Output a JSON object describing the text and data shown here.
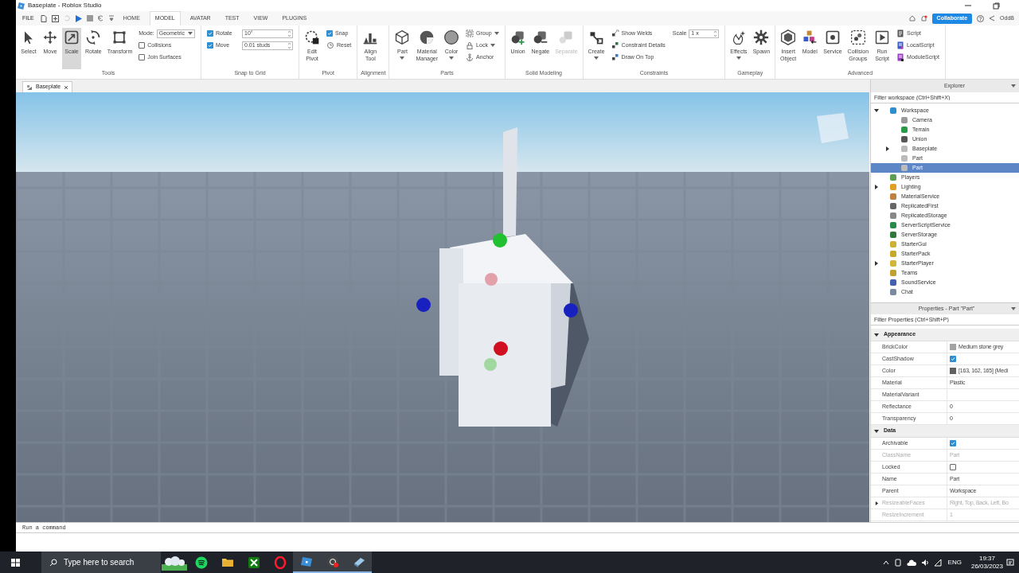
{
  "window": {
    "title": "Baseplate - Roblox Studio"
  },
  "menu": {
    "file": "FILE",
    "tabs": [
      {
        "label": "HOME",
        "selected": false
      },
      {
        "label": "MODEL",
        "selected": true
      },
      {
        "label": "AVATAR",
        "selected": false
      },
      {
        "label": "TEST",
        "selected": false
      },
      {
        "label": "VIEW",
        "selected": false
      },
      {
        "label": "PLUGINS",
        "selected": false
      }
    ],
    "collaborate": "Collaborate",
    "user": "OddB"
  },
  "ribbon": [
    {
      "title": "Tools",
      "items": [
        {
          "kind": "big",
          "label": "Select",
          "selected": false
        },
        {
          "kind": "big",
          "label": "Move",
          "selected": false
        },
        {
          "kind": "big",
          "label": "Scale",
          "selected": true
        },
        {
          "kind": "big",
          "label": "Rotate",
          "selected": false
        },
        {
          "kind": "big",
          "label": "Transform",
          "selected": false
        },
        {
          "kind": "stack",
          "items": [
            {
              "kind": "dropdown",
              "label": "Mode:",
              "value": "Geometric"
            },
            {
              "kind": "check",
              "label": "Collisions",
              "checked": false
            },
            {
              "kind": "check",
              "label": "Join Surfaces",
              "checked": false
            }
          ]
        }
      ]
    },
    {
      "title": "Snap to Grid",
      "items": [
        {
          "kind": "stack",
          "items": [
            {
              "kind": "check_field",
              "label": "Rotate",
              "checked": true,
              "value": "10°"
            },
            {
              "kind": "check_field",
              "label": "Move",
              "checked": true,
              "value": "0.01 studs"
            }
          ]
        }
      ]
    },
    {
      "title": "Pivot",
      "items": [
        {
          "kind": "big",
          "label": "Edit Pivot"
        },
        {
          "kind": "stack",
          "items": [
            {
              "kind": "check",
              "label": "Snap",
              "checked": true
            },
            {
              "kind": "small",
              "label": "Reset",
              "menu": false
            }
          ]
        }
      ]
    },
    {
      "title": "Alignment",
      "items": [
        {
          "kind": "big",
          "label": "Align Tool"
        }
      ]
    },
    {
      "title": "Parts",
      "items": [
        {
          "kind": "big",
          "label": "Part",
          "dropdown": true
        },
        {
          "kind": "big",
          "label": "Material Manager",
          "dropdown": false
        },
        {
          "kind": "big",
          "label": "Color",
          "dropdown": true
        },
        {
          "kind": "stack",
          "items": [
            {
              "kind": "small",
              "label": "Group",
              "menu": true
            },
            {
              "kind": "small",
              "label": "Lock",
              "menu": true
            },
            {
              "kind": "small",
              "label": "Anchor",
              "menu": false
            }
          ]
        }
      ]
    },
    {
      "title": "Solid Modeling",
      "items": [
        {
          "kind": "big",
          "label": "Union",
          "disabled": false
        },
        {
          "kind": "big",
          "label": "Negate",
          "disabled": false
        },
        {
          "kind": "big",
          "label": "Separate",
          "disabled": true
        }
      ]
    },
    {
      "title": "Constraints",
      "items": [
        {
          "kind": "big",
          "label": "Create",
          "dropdown": true
        },
        {
          "kind": "stack",
          "items": [
            {
              "kind": "small",
              "label": "Show Welds",
              "menu": false
            },
            {
              "kind": "small",
              "label": "Constraint Details",
              "menu": false
            },
            {
              "kind": "small",
              "label": "Draw On Top",
              "menu": false
            }
          ]
        },
        {
          "kind": "stack",
          "items": [
            {
              "kind": "field",
              "label": "Scale",
              "value": "1 x"
            }
          ]
        }
      ]
    },
    {
      "title": "Gameplay",
      "items": [
        {
          "kind": "big",
          "label": "Effects",
          "dropdown": true
        },
        {
          "kind": "big",
          "label": "Spawn",
          "dropdown": false
        }
      ]
    },
    {
      "title": "Advanced",
      "items": [
        {
          "kind": "big",
          "label": "Insert Object"
        },
        {
          "kind": "big",
          "label": "Model"
        },
        {
          "kind": "big",
          "label": "Service"
        },
        {
          "kind": "big",
          "label": "Collision Groups"
        },
        {
          "kind": "big",
          "label": "Run Script"
        },
        {
          "kind": "stack",
          "items": [
            {
              "kind": "small",
              "label": "Script",
              "menu": false
            },
            {
              "kind": "small",
              "label": "LocalScript",
              "menu": false
            },
            {
              "kind": "small",
              "label": "ModuleScript",
              "menu": false
            }
          ]
        }
      ]
    }
  ],
  "document_tabs": [
    {
      "label": "Baseplate",
      "selected": true
    }
  ],
  "explorer": {
    "title": "Explorer",
    "filter": {
      "placeholder": "Filter workspace (Ctrl+Shift+X)"
    },
    "items": [
      {
        "label": "Workspace",
        "color": "#2a8fd0",
        "selected": false,
        "expanded": true,
        "children": [
          {
            "label": "Camera",
            "color": "#9a9a9a",
            "selected": false
          },
          {
            "label": "Terrain",
            "color": "#2a9a4a",
            "selected": false
          },
          {
            "label": "Union",
            "color": "#555555",
            "selected": false
          },
          {
            "label": "Baseplate",
            "color": "#bbbbbb",
            "selected": false,
            "expanded": false
          },
          {
            "label": "Part",
            "color": "#bbbbbb",
            "selected": false
          },
          {
            "label": "Part",
            "color": "#bbbbbb",
            "selected": true
          }
        ]
      },
      {
        "label": "Players",
        "color": "#5aa050",
        "selected": false
      },
      {
        "label": "Lighting",
        "color": "#e0a020",
        "selected": false,
        "expanded": false
      },
      {
        "label": "MaterialService",
        "color": "#c08040",
        "selected": false
      },
      {
        "label": "ReplicatedFirst",
        "color": "#666666",
        "selected": false
      },
      {
        "label": "ReplicatedStorage",
        "color": "#888888",
        "selected": false
      },
      {
        "label": "ServerScriptService",
        "color": "#2a8a4a",
        "selected": false
      },
      {
        "label": "ServerStorage",
        "color": "#2f7a3a",
        "selected": false
      },
      {
        "label": "StarterGui",
        "color": "#d0b030",
        "selected": false
      },
      {
        "label": "StarterPack",
        "color": "#c8a828",
        "selected": false
      },
      {
        "label": "StarterPlayer",
        "color": "#d4b43a",
        "selected": false,
        "expanded": false
      },
      {
        "label": "Teams",
        "color": "#c0a030",
        "selected": false
      },
      {
        "label": "SoundService",
        "color": "#4060b0",
        "selected": false
      },
      {
        "label": "Chat",
        "color": "#7a8aa0",
        "selected": false
      }
    ]
  },
  "properties": {
    "title": "Properties - Part \"Part\"",
    "filter": {
      "placeholder": "Filter Properties (Ctrl+Shift+P)"
    },
    "sections": [
      {
        "name": "Appearance",
        "expanded": true,
        "rows": [
          {
            "name": "BrickColor",
            "kind": "color",
            "value": "Medium stone grey",
            "color": "#a3a2a5",
            "disabled": false
          },
          {
            "name": "CastShadow",
            "kind": "check",
            "checked": true,
            "disabled": false
          },
          {
            "name": "Color",
            "kind": "color",
            "value": "[163, 162, 165] (Medi",
            "color": "#606060",
            "disabled": false
          },
          {
            "name": "Material",
            "kind": "text",
            "value": "Plastic",
            "disabled": false
          },
          {
            "name": "MaterialVariant",
            "kind": "text",
            "disabled": false
          },
          {
            "name": "Reflectance",
            "kind": "text",
            "value": "0",
            "disabled": false
          },
          {
            "name": "Transparency",
            "kind": "text",
            "value": "0",
            "disabled": false
          }
        ]
      },
      {
        "name": "Data",
        "expanded": true,
        "rows": [
          {
            "name": "Archivable",
            "kind": "check",
            "checked": true,
            "disabled": false
          },
          {
            "name": "ClassName",
            "kind": "text",
            "value": "Part",
            "disabled": true
          },
          {
            "name": "Locked",
            "kind": "check",
            "checked": false,
            "disabled": false
          },
          {
            "name": "Name",
            "kind": "text",
            "value": "Part",
            "disabled": false
          },
          {
            "name": "Parent",
            "kind": "text",
            "value": "Workspace",
            "disabled": false
          },
          {
            "name": "ResizeableFaces",
            "kind": "text",
            "value": "Right, Top, Back, Left, Bo",
            "disabled": true,
            "expanded": false
          },
          {
            "name": "ResizeIncrement",
            "kind": "text",
            "value": "1",
            "disabled": true
          }
        ]
      }
    ]
  },
  "command_bar": {
    "placeholder": "Run a command"
  },
  "taskbar": {
    "search": {
      "placeholder": "Type here to search"
    },
    "apps": [
      {
        "running": false
      },
      {
        "running": false
      },
      {
        "running": false
      },
      {
        "running": false
      },
      {
        "running": true
      },
      {
        "running": true
      },
      {
        "running": true
      }
    ],
    "language": "ENG",
    "time": "19:37",
    "date": "26/03/2023"
  }
}
